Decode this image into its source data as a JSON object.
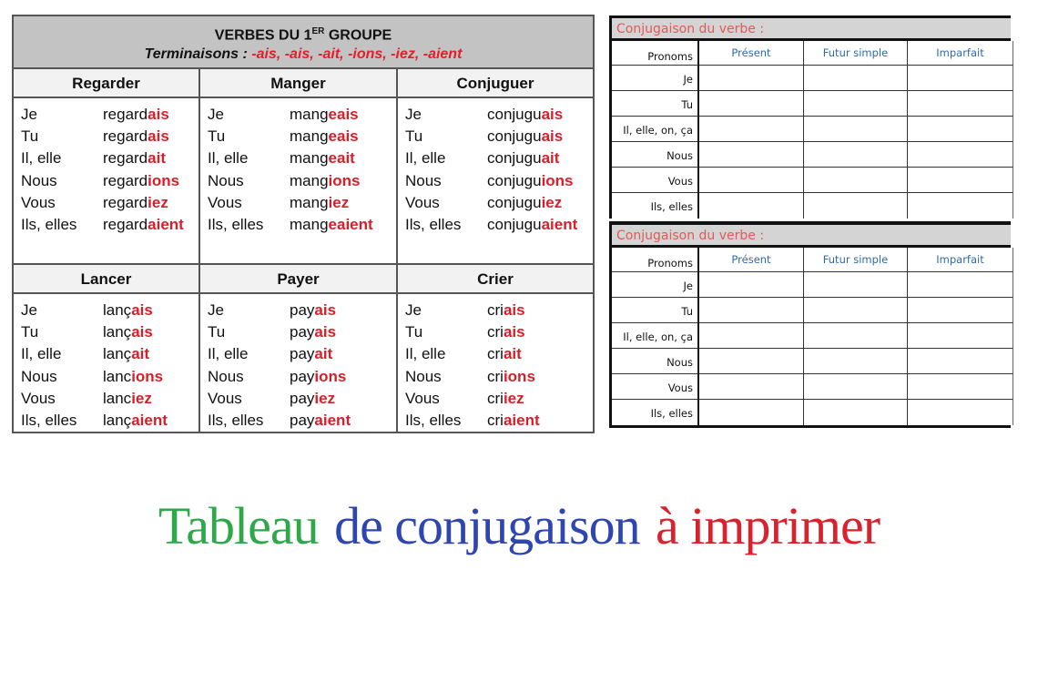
{
  "left_table": {
    "title": "VERBES DU 1",
    "title_sup": "ER",
    "title_suffix": " GROUPE",
    "subtitle_label": "Terminaisons : ",
    "subtitle_endings": "-ais, -ais, -ait, -ions, -iez, -aient",
    "rows": [
      [
        {
          "verb": "Regarder",
          "lines": [
            {
              "pronoun": "Je",
              "stem": "regard",
              "ending": "ais"
            },
            {
              "pronoun": "Tu",
              "stem": "regard",
              "ending": "ais"
            },
            {
              "pronoun": "Il, elle",
              "stem": "regard",
              "ending": "ait"
            },
            {
              "pronoun": "Nous",
              "stem": "regard",
              "ending": "ions"
            },
            {
              "pronoun": "Vous",
              "stem": "regard",
              "ending": "iez"
            },
            {
              "pronoun": "Ils, elles",
              "stem": "regard",
              "ending": "aient"
            }
          ]
        },
        {
          "verb": "Manger",
          "lines": [
            {
              "pronoun": "Je",
              "stem": "mang",
              "ending": "eais"
            },
            {
              "pronoun": "Tu",
              "stem": "mang",
              "ending": "eais"
            },
            {
              "pronoun": "Il, elle",
              "stem": "mang",
              "ending": "eait"
            },
            {
              "pronoun": "Nous",
              "stem": "mang",
              "ending": "ions"
            },
            {
              "pronoun": "Vous",
              "stem": "mang",
              "ending": "iez"
            },
            {
              "pronoun": "Ils, elles",
              "stem": "mang",
              "ending": "eaient"
            }
          ]
        },
        {
          "verb": "Conjuguer",
          "lines": [
            {
              "pronoun": "Je",
              "stem": "conjugu",
              "ending": "ais"
            },
            {
              "pronoun": "Tu",
              "stem": "conjugu",
              "ending": "ais"
            },
            {
              "pronoun": "Il, elle",
              "stem": "conjugu",
              "ending": "ait"
            },
            {
              "pronoun": "Nous",
              "stem": "conjugu",
              "ending": "ions"
            },
            {
              "pronoun": "Vous",
              "stem": "conjugu",
              "ending": "iez"
            },
            {
              "pronoun": "Ils, elles",
              "stem": "conjugu",
              "ending": "aient"
            }
          ]
        }
      ],
      [
        {
          "verb": "Lancer",
          "lines": [
            {
              "pronoun": "Je",
              "stem": "lanç",
              "ending": "ais"
            },
            {
              "pronoun": "Tu",
              "stem": "lanç",
              "ending": "ais"
            },
            {
              "pronoun": "Il, elle",
              "stem": "lanç",
              "ending": "ait"
            },
            {
              "pronoun": "Nous",
              "stem": "lanc",
              "ending": "ions"
            },
            {
              "pronoun": "Vous",
              "stem": "lanc",
              "ending": "iez"
            },
            {
              "pronoun": "Ils, elles",
              "stem": "lanç",
              "ending": "aient"
            }
          ]
        },
        {
          "verb": "Payer",
          "lines": [
            {
              "pronoun": "Je",
              "stem": "pay",
              "ending": "ais"
            },
            {
              "pronoun": "Tu",
              "stem": "pay",
              "ending": "ais"
            },
            {
              "pronoun": "Il, elle",
              "stem": "pay",
              "ending": "ait"
            },
            {
              "pronoun": "Nous",
              "stem": "pay",
              "ending": "ions"
            },
            {
              "pronoun": "Vous",
              "stem": "pay",
              "ending": "iez"
            },
            {
              "pronoun": "Ils, elles",
              "stem": "pay",
              "ending": "aient"
            }
          ]
        },
        {
          "verb": "Crier",
          "lines": [
            {
              "pronoun": "Je",
              "stem": "cri",
              "ending": "ais"
            },
            {
              "pronoun": "Tu",
              "stem": "cri",
              "ending": "ais"
            },
            {
              "pronoun": "Il, elle",
              "stem": "cri",
              "ending": "ait"
            },
            {
              "pronoun": "Nous",
              "stem": "cri",
              "ending": "ions"
            },
            {
              "pronoun": "Vous",
              "stem": "cri",
              "ending": "iez"
            },
            {
              "pronoun": "Ils, elles",
              "stem": "cri",
              "ending": "aient"
            }
          ]
        }
      ]
    ]
  },
  "worksheets": [
    {
      "title": "Conjugaison du verbe :",
      "headers": [
        "Pronoms",
        "Présent",
        "Futur simple",
        "Imparfait"
      ],
      "pronouns": [
        "Je",
        "Tu",
        "Il, elle, on, ça",
        "Nous",
        "Vous",
        "Ils, elles"
      ]
    },
    {
      "title": "Conjugaison du verbe :",
      "headers": [
        "Pronoms",
        "Présent",
        "Futur simple",
        "Imparfait"
      ],
      "pronouns": [
        "Je",
        "Tu",
        "Il, elle, on, ça",
        "Nous",
        "Vous",
        "Ils, elles"
      ]
    }
  ],
  "caption": {
    "part1": "Tableau",
    "part2": "de conjugaison",
    "part3": "à imprimer",
    "colors": {
      "part1": "#2ea84a",
      "part2": "#2f46b0",
      "part3": "#d8232e"
    }
  },
  "colors": {
    "ending_red": "#d71f2a",
    "header_gray": "#c3c3c3",
    "worksheet_title": "#e05a58",
    "worksheet_header_blue": "#2f6aa6"
  }
}
